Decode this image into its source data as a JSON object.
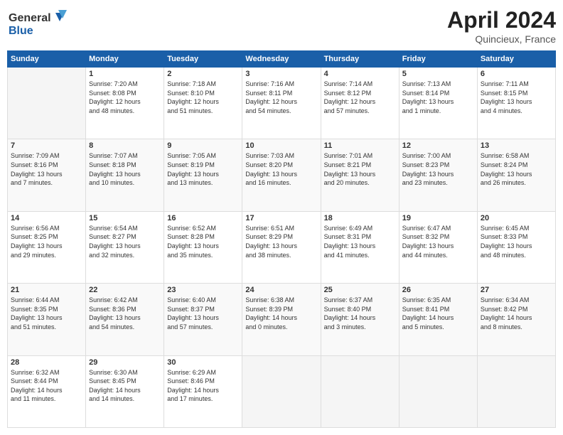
{
  "header": {
    "logo_line1": "General",
    "logo_line2": "Blue",
    "month": "April 2024",
    "location": "Quincieux, France"
  },
  "days_of_week": [
    "Sunday",
    "Monday",
    "Tuesday",
    "Wednesday",
    "Thursday",
    "Friday",
    "Saturday"
  ],
  "weeks": [
    [
      {
        "day": "",
        "info": ""
      },
      {
        "day": "1",
        "info": "Sunrise: 7:20 AM\nSunset: 8:08 PM\nDaylight: 12 hours\nand 48 minutes."
      },
      {
        "day": "2",
        "info": "Sunrise: 7:18 AM\nSunset: 8:10 PM\nDaylight: 12 hours\nand 51 minutes."
      },
      {
        "day": "3",
        "info": "Sunrise: 7:16 AM\nSunset: 8:11 PM\nDaylight: 12 hours\nand 54 minutes."
      },
      {
        "day": "4",
        "info": "Sunrise: 7:14 AM\nSunset: 8:12 PM\nDaylight: 12 hours\nand 57 minutes."
      },
      {
        "day": "5",
        "info": "Sunrise: 7:13 AM\nSunset: 8:14 PM\nDaylight: 13 hours\nand 1 minute."
      },
      {
        "day": "6",
        "info": "Sunrise: 7:11 AM\nSunset: 8:15 PM\nDaylight: 13 hours\nand 4 minutes."
      }
    ],
    [
      {
        "day": "7",
        "info": "Sunrise: 7:09 AM\nSunset: 8:16 PM\nDaylight: 13 hours\nand 7 minutes."
      },
      {
        "day": "8",
        "info": "Sunrise: 7:07 AM\nSunset: 8:18 PM\nDaylight: 13 hours\nand 10 minutes."
      },
      {
        "day": "9",
        "info": "Sunrise: 7:05 AM\nSunset: 8:19 PM\nDaylight: 13 hours\nand 13 minutes."
      },
      {
        "day": "10",
        "info": "Sunrise: 7:03 AM\nSunset: 8:20 PM\nDaylight: 13 hours\nand 16 minutes."
      },
      {
        "day": "11",
        "info": "Sunrise: 7:01 AM\nSunset: 8:21 PM\nDaylight: 13 hours\nand 20 minutes."
      },
      {
        "day": "12",
        "info": "Sunrise: 7:00 AM\nSunset: 8:23 PM\nDaylight: 13 hours\nand 23 minutes."
      },
      {
        "day": "13",
        "info": "Sunrise: 6:58 AM\nSunset: 8:24 PM\nDaylight: 13 hours\nand 26 minutes."
      }
    ],
    [
      {
        "day": "14",
        "info": "Sunrise: 6:56 AM\nSunset: 8:25 PM\nDaylight: 13 hours\nand 29 minutes."
      },
      {
        "day": "15",
        "info": "Sunrise: 6:54 AM\nSunset: 8:27 PM\nDaylight: 13 hours\nand 32 minutes."
      },
      {
        "day": "16",
        "info": "Sunrise: 6:52 AM\nSunset: 8:28 PM\nDaylight: 13 hours\nand 35 minutes."
      },
      {
        "day": "17",
        "info": "Sunrise: 6:51 AM\nSunset: 8:29 PM\nDaylight: 13 hours\nand 38 minutes."
      },
      {
        "day": "18",
        "info": "Sunrise: 6:49 AM\nSunset: 8:31 PM\nDaylight: 13 hours\nand 41 minutes."
      },
      {
        "day": "19",
        "info": "Sunrise: 6:47 AM\nSunset: 8:32 PM\nDaylight: 13 hours\nand 44 minutes."
      },
      {
        "day": "20",
        "info": "Sunrise: 6:45 AM\nSunset: 8:33 PM\nDaylight: 13 hours\nand 48 minutes."
      }
    ],
    [
      {
        "day": "21",
        "info": "Sunrise: 6:44 AM\nSunset: 8:35 PM\nDaylight: 13 hours\nand 51 minutes."
      },
      {
        "day": "22",
        "info": "Sunrise: 6:42 AM\nSunset: 8:36 PM\nDaylight: 13 hours\nand 54 minutes."
      },
      {
        "day": "23",
        "info": "Sunrise: 6:40 AM\nSunset: 8:37 PM\nDaylight: 13 hours\nand 57 minutes."
      },
      {
        "day": "24",
        "info": "Sunrise: 6:38 AM\nSunset: 8:39 PM\nDaylight: 14 hours\nand 0 minutes."
      },
      {
        "day": "25",
        "info": "Sunrise: 6:37 AM\nSunset: 8:40 PM\nDaylight: 14 hours\nand 3 minutes."
      },
      {
        "day": "26",
        "info": "Sunrise: 6:35 AM\nSunset: 8:41 PM\nDaylight: 14 hours\nand 5 minutes."
      },
      {
        "day": "27",
        "info": "Sunrise: 6:34 AM\nSunset: 8:42 PM\nDaylight: 14 hours\nand 8 minutes."
      }
    ],
    [
      {
        "day": "28",
        "info": "Sunrise: 6:32 AM\nSunset: 8:44 PM\nDaylight: 14 hours\nand 11 minutes."
      },
      {
        "day": "29",
        "info": "Sunrise: 6:30 AM\nSunset: 8:45 PM\nDaylight: 14 hours\nand 14 minutes."
      },
      {
        "day": "30",
        "info": "Sunrise: 6:29 AM\nSunset: 8:46 PM\nDaylight: 14 hours\nand 17 minutes."
      },
      {
        "day": "",
        "info": ""
      },
      {
        "day": "",
        "info": ""
      },
      {
        "day": "",
        "info": ""
      },
      {
        "day": "",
        "info": ""
      }
    ]
  ]
}
